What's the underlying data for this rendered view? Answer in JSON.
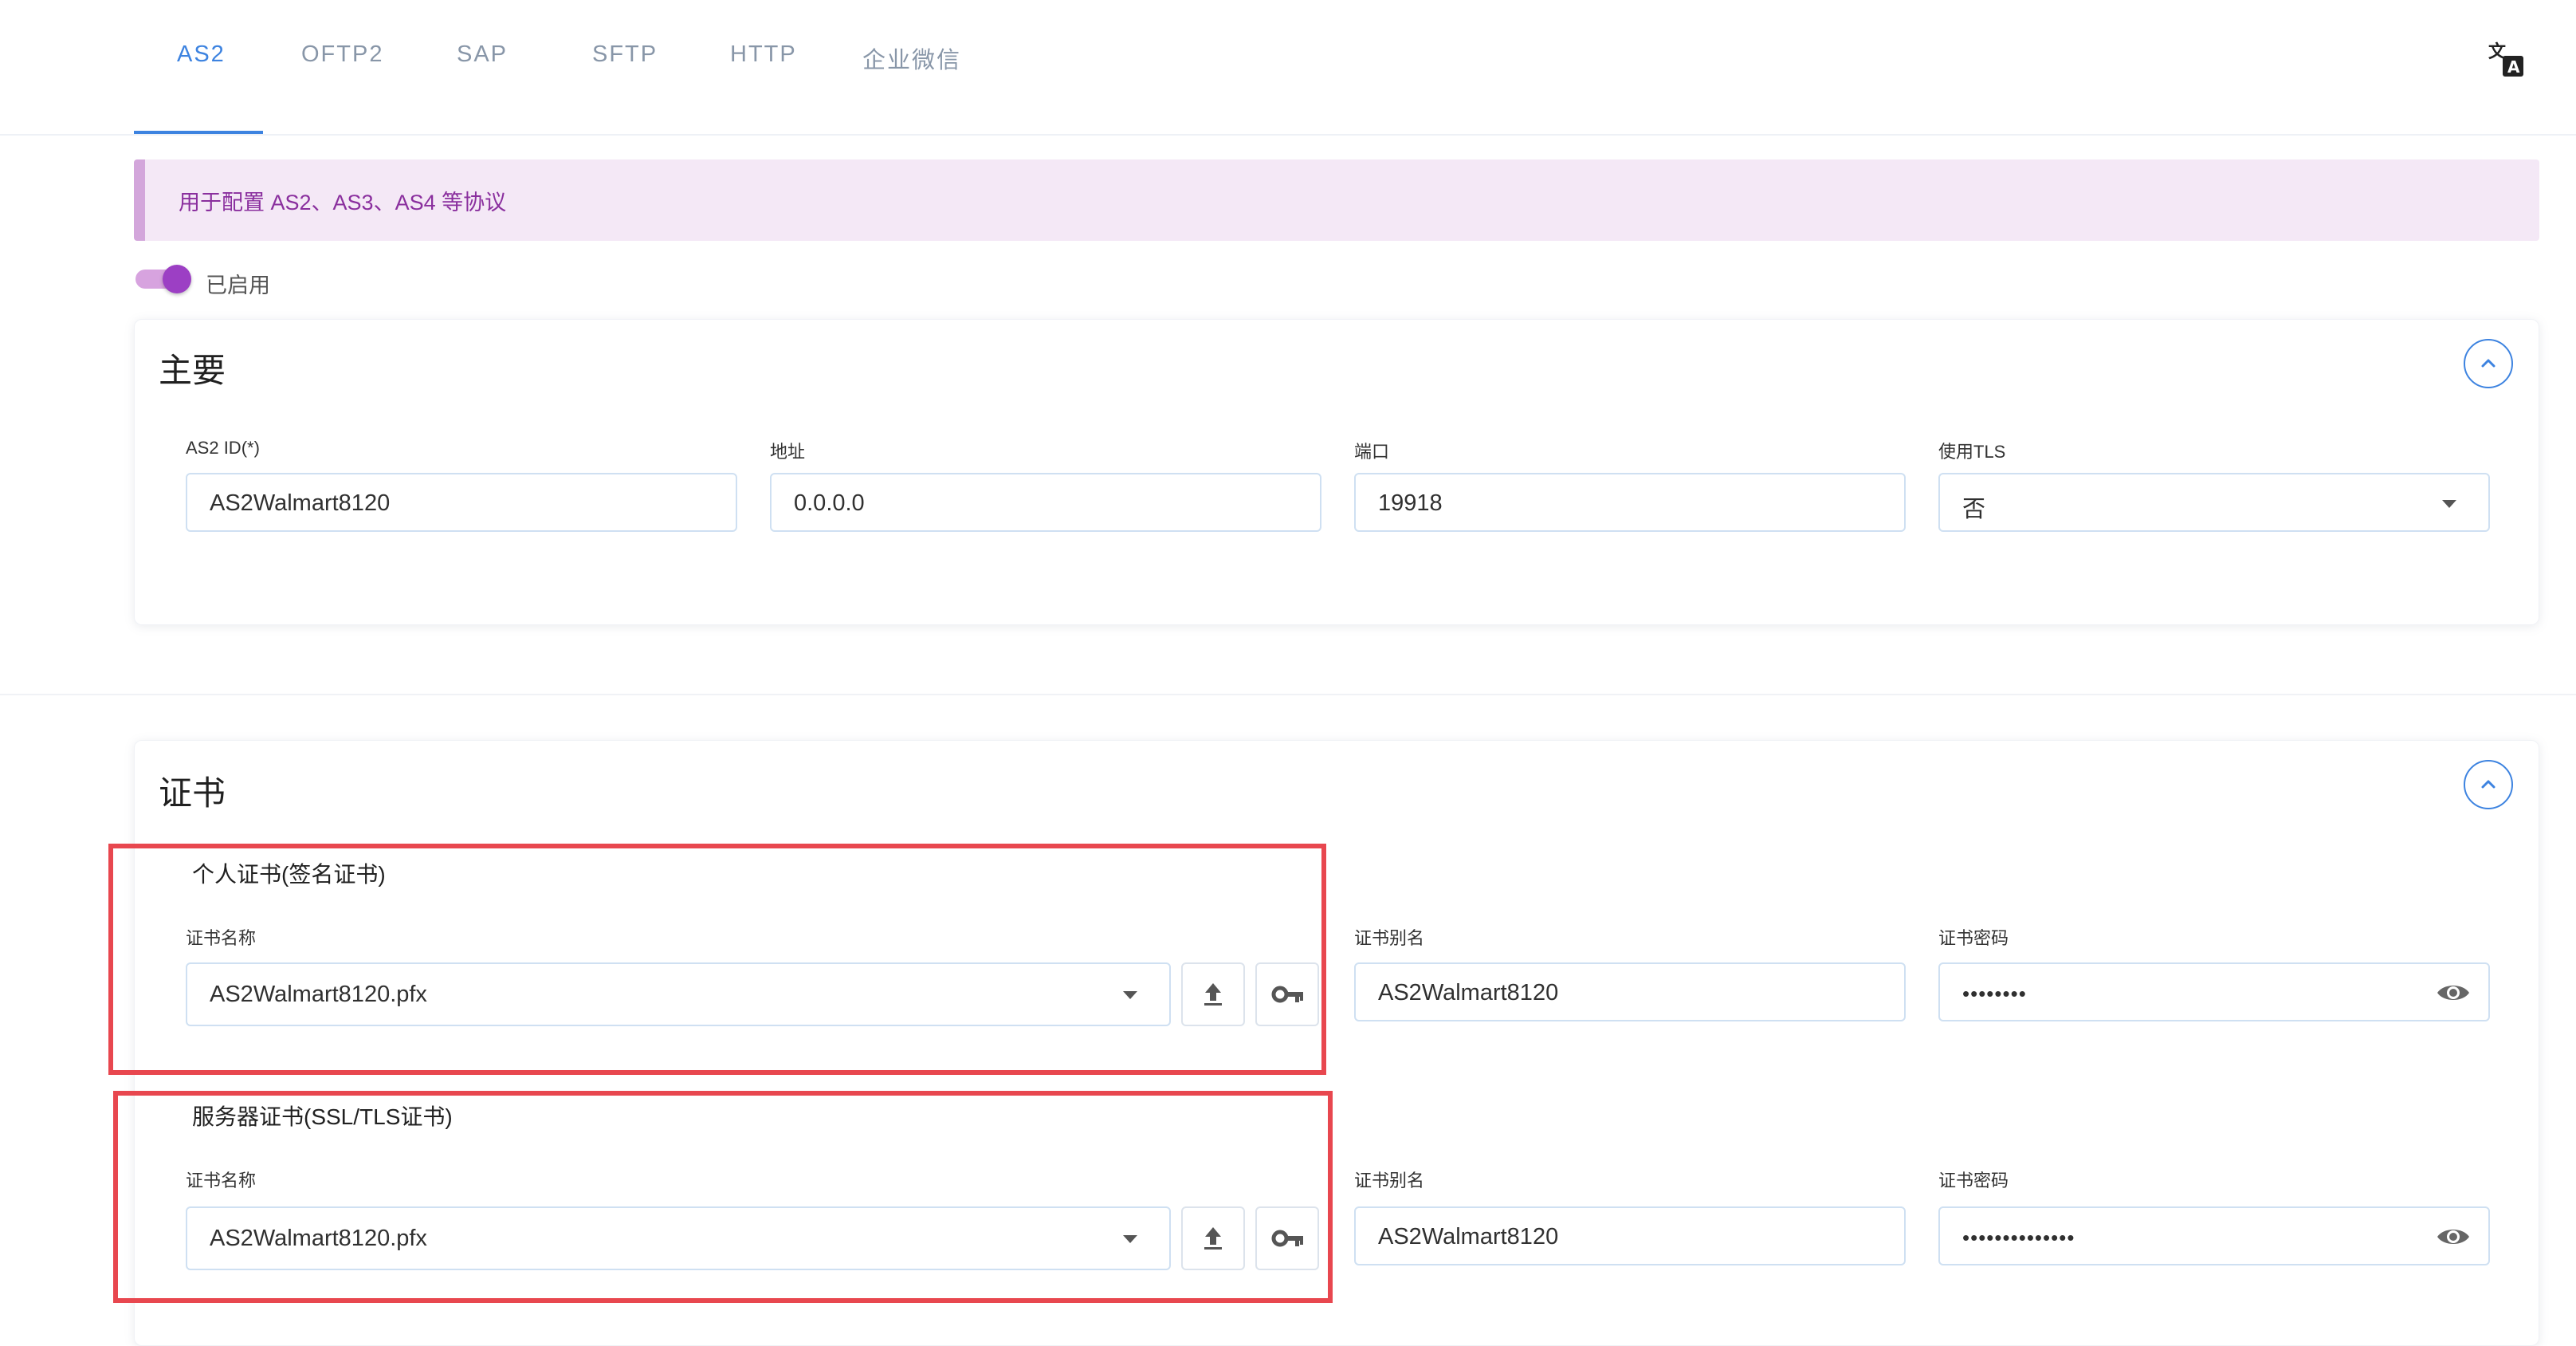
{
  "tabs": [
    {
      "label": "AS2",
      "active": true
    },
    {
      "label": "OFTP2",
      "active": false
    },
    {
      "label": "SAP",
      "active": false
    },
    {
      "label": "SFTP",
      "active": false
    },
    {
      "label": "HTTP",
      "active": false
    },
    {
      "label": "企业微信",
      "active": false
    }
  ],
  "banner": {
    "text": "用于配置 AS2、AS3、AS4 等协议"
  },
  "toggle": {
    "label": "已启用",
    "on": true
  },
  "main_section": {
    "title": "主要",
    "fields": {
      "as2_id": {
        "label": "AS2 ID(*)",
        "value": "AS2Walmart8120"
      },
      "address": {
        "label": "地址",
        "value": "0.0.0.0"
      },
      "port": {
        "label": "端口",
        "value": "19918"
      },
      "use_tls": {
        "label": "使用TLS",
        "value": "否"
      }
    }
  },
  "cert_section": {
    "title": "证书",
    "personal": {
      "title": "个人证书(签名证书)",
      "name_label": "证书名称",
      "name_value": "AS2Walmart8120.pfx",
      "alias_label": "证书别名",
      "alias_value": "AS2Walmart8120",
      "password_label": "证书密码",
      "password_value": "••••••••"
    },
    "server": {
      "title": "服务器证书(SSL/TLS证书)",
      "name_label": "证书名称",
      "name_value": "AS2Walmart8120.pfx",
      "alias_label": "证书别名",
      "alias_value": "AS2Walmart8120",
      "password_label": "证书密码",
      "password_value": "••••••••••••••"
    }
  },
  "colors": {
    "accent": "#3d83e0",
    "toggle": "#9c3fc4",
    "banner_bg": "#f4e8f6",
    "highlight_box": "#e8474f"
  },
  "icons": {
    "language": "translate-icon",
    "collapse": "chevron-up-icon",
    "dropdown": "caret-down-icon",
    "upload": "upload-icon",
    "key": "key-icon",
    "visibility": "eye-icon"
  }
}
